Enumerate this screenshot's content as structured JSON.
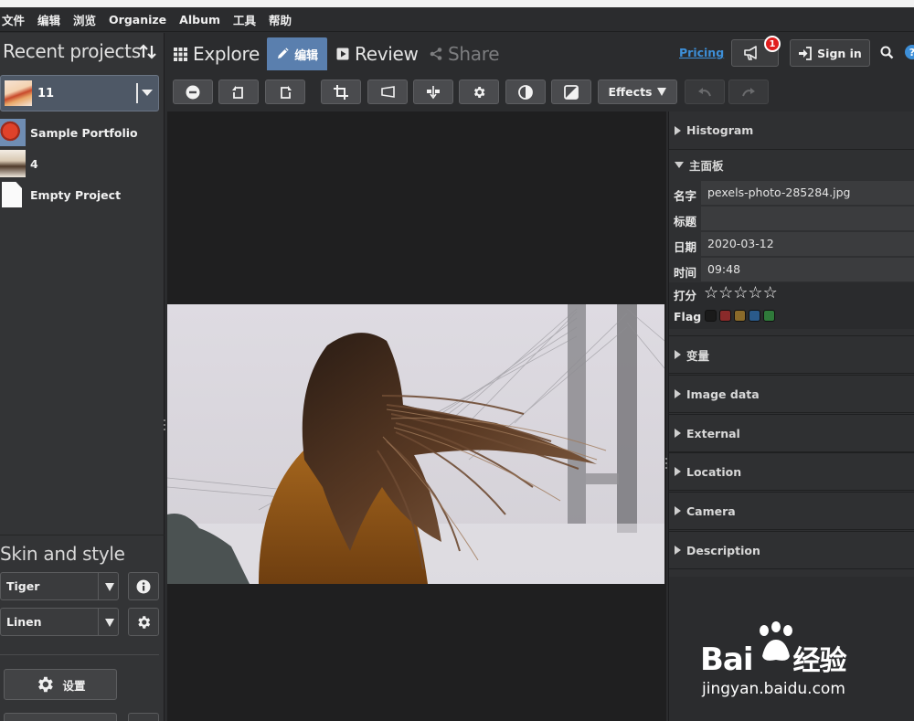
{
  "menubar": {
    "items": [
      "文件",
      "编辑",
      "浏览",
      "Organize",
      "Album",
      "工具",
      "帮助"
    ]
  },
  "left_panel": {
    "recent_title": "Recent projects",
    "current_project": {
      "label": "11"
    },
    "projects": [
      {
        "label": "Sample Portfolio"
      },
      {
        "label": "4"
      },
      {
        "label": "Empty Project"
      }
    ],
    "skin_title": "Skin and style",
    "skin_value": "Tiger",
    "style_value": "Linen",
    "settings_label": "设置"
  },
  "navbar": {
    "tabs": [
      {
        "label": "Explore",
        "icon": "grid-icon"
      },
      {
        "label": "编辑",
        "icon": "pencil-icon",
        "active": true
      },
      {
        "label": "Review",
        "icon": "play-icon"
      },
      {
        "label": "Share",
        "icon": "share-icon"
      }
    ],
    "pricing_label": "Pricing",
    "notification_count": "1",
    "signin_label": "Sign in",
    "help_label": "?"
  },
  "toolbar": {
    "effects_label": "Effects",
    "icons": [
      "minus-circle-icon",
      "rotate-left-icon",
      "rotate-right-icon",
      "crop-icon",
      "straighten-icon",
      "flip-icon",
      "adjust-gear-icon",
      "contrast-icon",
      "exposure-icon",
      "undo-icon",
      "redo-icon"
    ]
  },
  "right_panel": {
    "histogram_label": "Histogram",
    "main_label": "主面板",
    "name_label": "名字",
    "name_value": "pexels-photo-285284.jpg",
    "title_label": "标题",
    "title_value": "",
    "date_label": "日期",
    "date_value": "2020-03-12",
    "time_label": "时间",
    "time_value": "09:48",
    "rating_label": "打分",
    "rating_value": 0,
    "rating_max": 5,
    "flag_label": "Flag",
    "flag_colors": [
      "#1a1a1a",
      "#8a2a2a",
      "#8a6a2a",
      "#2a5a8a",
      "#2f7a3a"
    ],
    "variables_label": "变量",
    "imagedata_label": "Image data",
    "external_label": "External",
    "location_label": "Location",
    "camera_label": "Camera",
    "description_label": "Description"
  },
  "watermark": {
    "brand": "Bai",
    "brand_cn": "经验",
    "domain": "jingyan.baidu.com"
  },
  "colors": {
    "accent": "#5a7fae",
    "link": "#3d8fd8",
    "badge": "#e01e1e"
  }
}
